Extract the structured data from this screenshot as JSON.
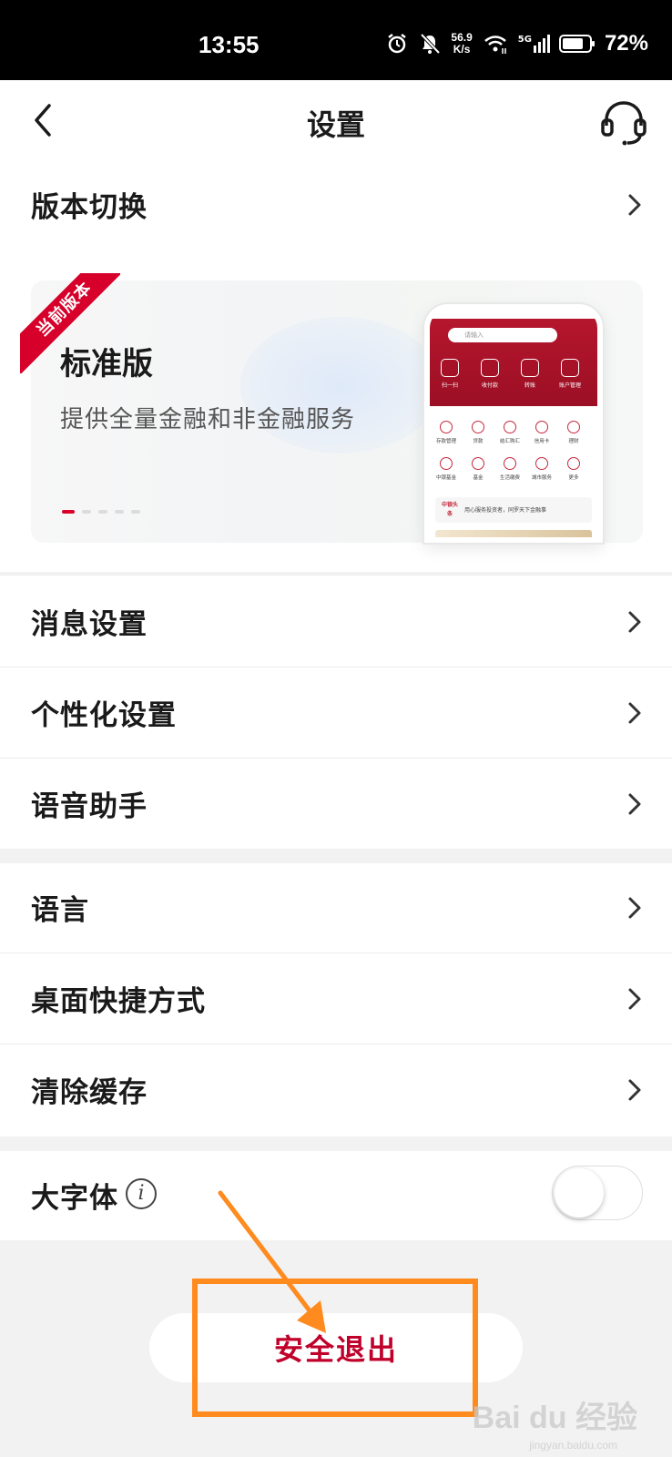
{
  "status_bar": {
    "time": "13:55",
    "net_speed_value": "56.9",
    "net_speed_unit": "K/s",
    "network": "5G",
    "battery": "72%",
    "icons": [
      "alarm-icon",
      "mute-icon",
      "wifi-icon",
      "signal-icon",
      "battery-icon"
    ]
  },
  "header": {
    "title": "设置",
    "back_icon": "chevron-left-icon",
    "service_icon": "headset-icon"
  },
  "version_switch": {
    "label": "版本切换"
  },
  "version_card": {
    "badge": "当前版本",
    "title": "标准版",
    "description": "提供全量金融和非金融服务",
    "carousel_pages": 5,
    "carousel_active": 1,
    "preview": {
      "search_placeholder": "请输入",
      "top_actions": [
        "扫一扫",
        "收付款",
        "转账",
        "账户管理"
      ],
      "grid_row1": [
        "存款管理",
        "贷款",
        "结汇购汇",
        "信用卡",
        "理财"
      ],
      "grid_row2": [
        "中银基金",
        "基金",
        "生活缴费",
        "城市服务",
        "更多"
      ],
      "news_tag": "中银头条",
      "news_text": "用心服务投资者，同罗天下金融事"
    }
  },
  "settings_group1": [
    {
      "label": "消息设置"
    },
    {
      "label": "个性化设置"
    },
    {
      "label": "语音助手"
    }
  ],
  "settings_group2": [
    {
      "label": "语言"
    },
    {
      "label": "桌面快捷方式"
    },
    {
      "label": "清除缓存"
    }
  ],
  "large_font": {
    "label": "大字体",
    "info_icon": "i",
    "enabled": false
  },
  "logout": {
    "label": "安全退出"
  },
  "annotation": {
    "highlight_color": "#ff8a1e"
  },
  "watermark": {
    "text": "Bai du 经验",
    "sub": "jingyan.baidu.com"
  },
  "colors": {
    "accent": "#c0002a",
    "badge": "#d6002a",
    "status_bar_bg": "#000000"
  }
}
